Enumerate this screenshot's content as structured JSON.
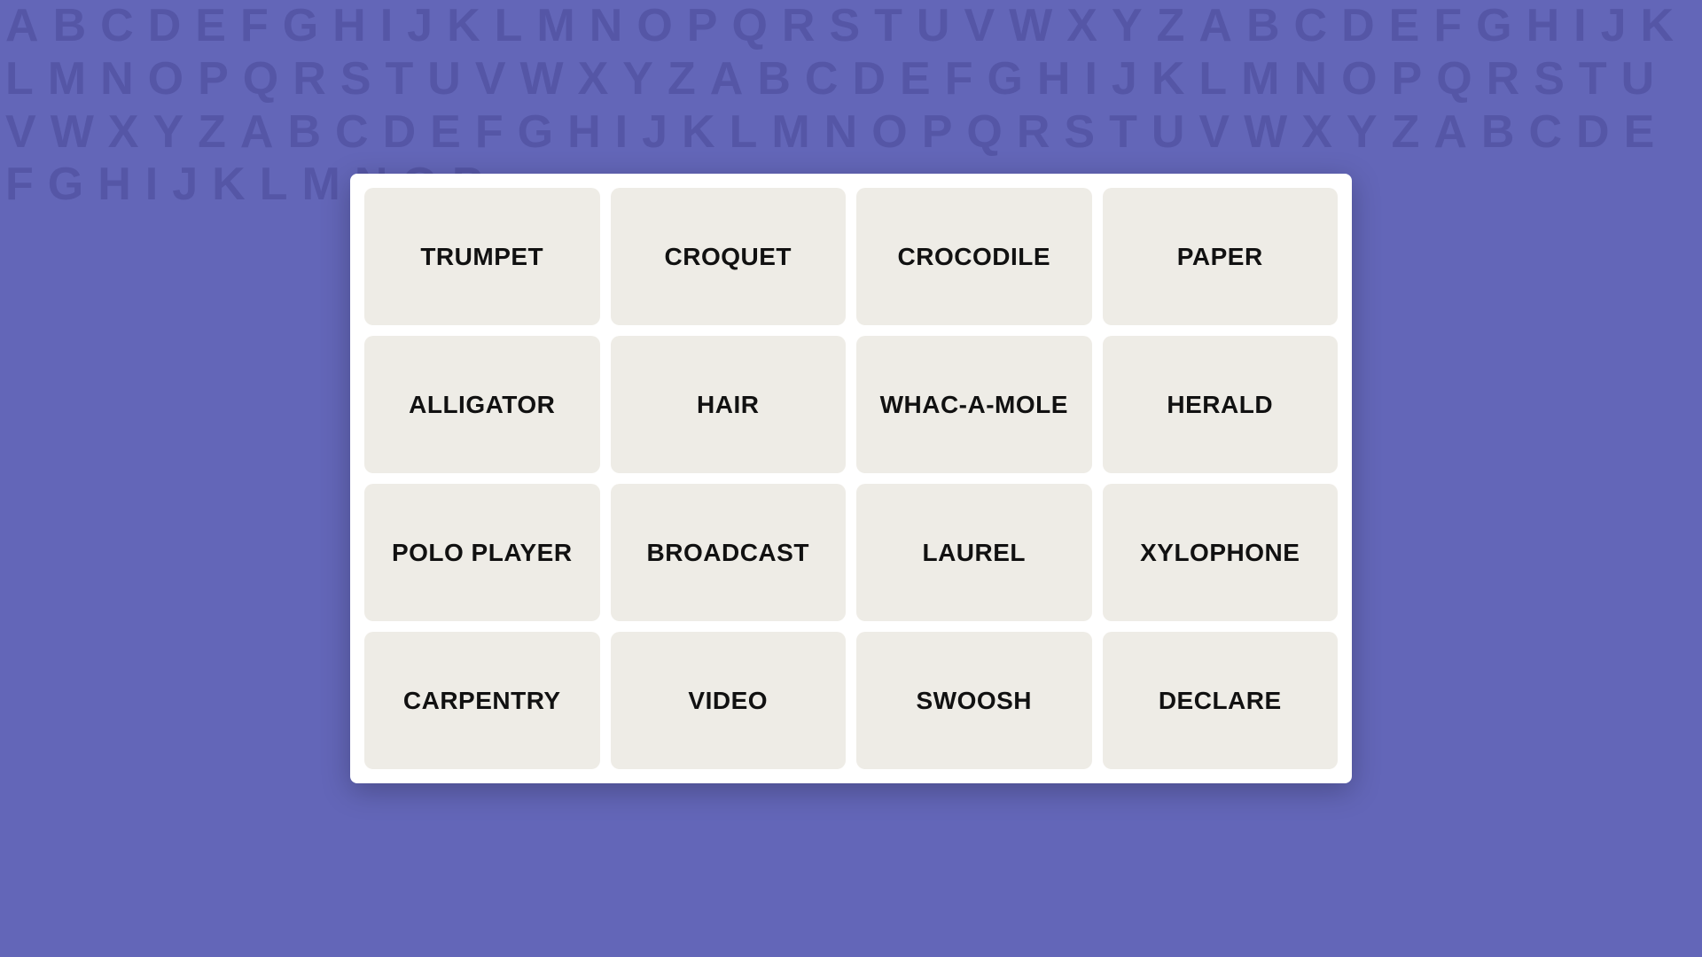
{
  "background": {
    "alphabet": "ABCDEFGHIJKLMNOPQRSTUVWXYZ"
  },
  "grid": {
    "items": [
      {
        "id": "trumpet",
        "label": "TRUMPET"
      },
      {
        "id": "croquet",
        "label": "CROQUET"
      },
      {
        "id": "crocodile",
        "label": "CROCODILE"
      },
      {
        "id": "paper",
        "label": "PAPER"
      },
      {
        "id": "alligator",
        "label": "ALLIGATOR"
      },
      {
        "id": "hair",
        "label": "HAIR"
      },
      {
        "id": "whac-a-mole",
        "label": "WHAC-A-MOLE"
      },
      {
        "id": "herald",
        "label": "HERALD"
      },
      {
        "id": "polo-player",
        "label": "POLO PLAYER"
      },
      {
        "id": "broadcast",
        "label": "BROADCAST"
      },
      {
        "id": "laurel",
        "label": "LAUREL"
      },
      {
        "id": "xylophone",
        "label": "XYLOPHONE"
      },
      {
        "id": "carpentry",
        "label": "CARPENTRY"
      },
      {
        "id": "video",
        "label": "VIDEO"
      },
      {
        "id": "swoosh",
        "label": "SWOOSH"
      },
      {
        "id": "declare",
        "label": "DECLARE"
      }
    ]
  }
}
